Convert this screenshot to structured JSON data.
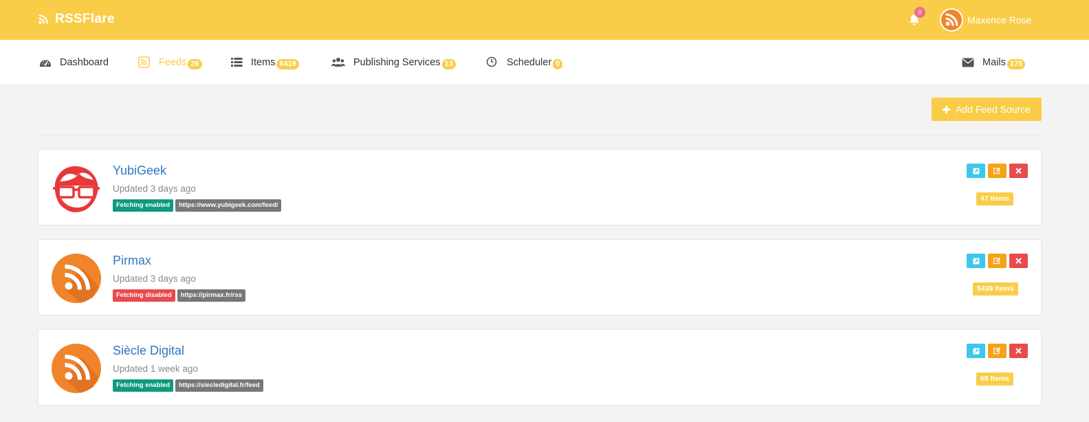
{
  "brand": {
    "name": "RSSFlare"
  },
  "header": {
    "notifications_count": "0",
    "user_name": "Maxence Rose"
  },
  "nav": {
    "dashboard": {
      "label": "Dashboard"
    },
    "feeds": {
      "label": "Feeds",
      "count": "26"
    },
    "items": {
      "label": "Items",
      "count": "6419"
    },
    "publishing": {
      "label": "Publishing Services",
      "count": "13"
    },
    "scheduler": {
      "label": "Scheduler",
      "count": "0"
    },
    "mails": {
      "label": "Mails",
      "count": "175"
    }
  },
  "toolbar": {
    "add_label": "Add Feed Source"
  },
  "feeds": [
    {
      "title": "YubiGeek",
      "updated": "Updated 3 days ago",
      "status": "Fetching enabled",
      "url": "https://www.yubigeek.com/feed/",
      "items": "47 Items",
      "logo": "geek-glasses-logo"
    },
    {
      "title": "Pirmax",
      "updated": "Updated 3 days ago",
      "status": "Fetching disabled",
      "url": "https://pirmax.fr/rss",
      "items": "5439 Items",
      "logo": "rss-logo"
    },
    {
      "title": "Siècle Digital",
      "updated": "Updated 1 week ago",
      "status": "Fetching enabled",
      "url": "https://siecledigital.fr/feed",
      "items": "68 Items",
      "logo": "rss-logo"
    }
  ],
  "colors": {
    "accent": "#f9cd48",
    "link": "#2e79c1",
    "enabled": "#0e9a7f",
    "disabled": "#e84b4b",
    "info": "#3cc8ea",
    "warning": "#f4a31a",
    "rss_orange": "#f0842a"
  }
}
